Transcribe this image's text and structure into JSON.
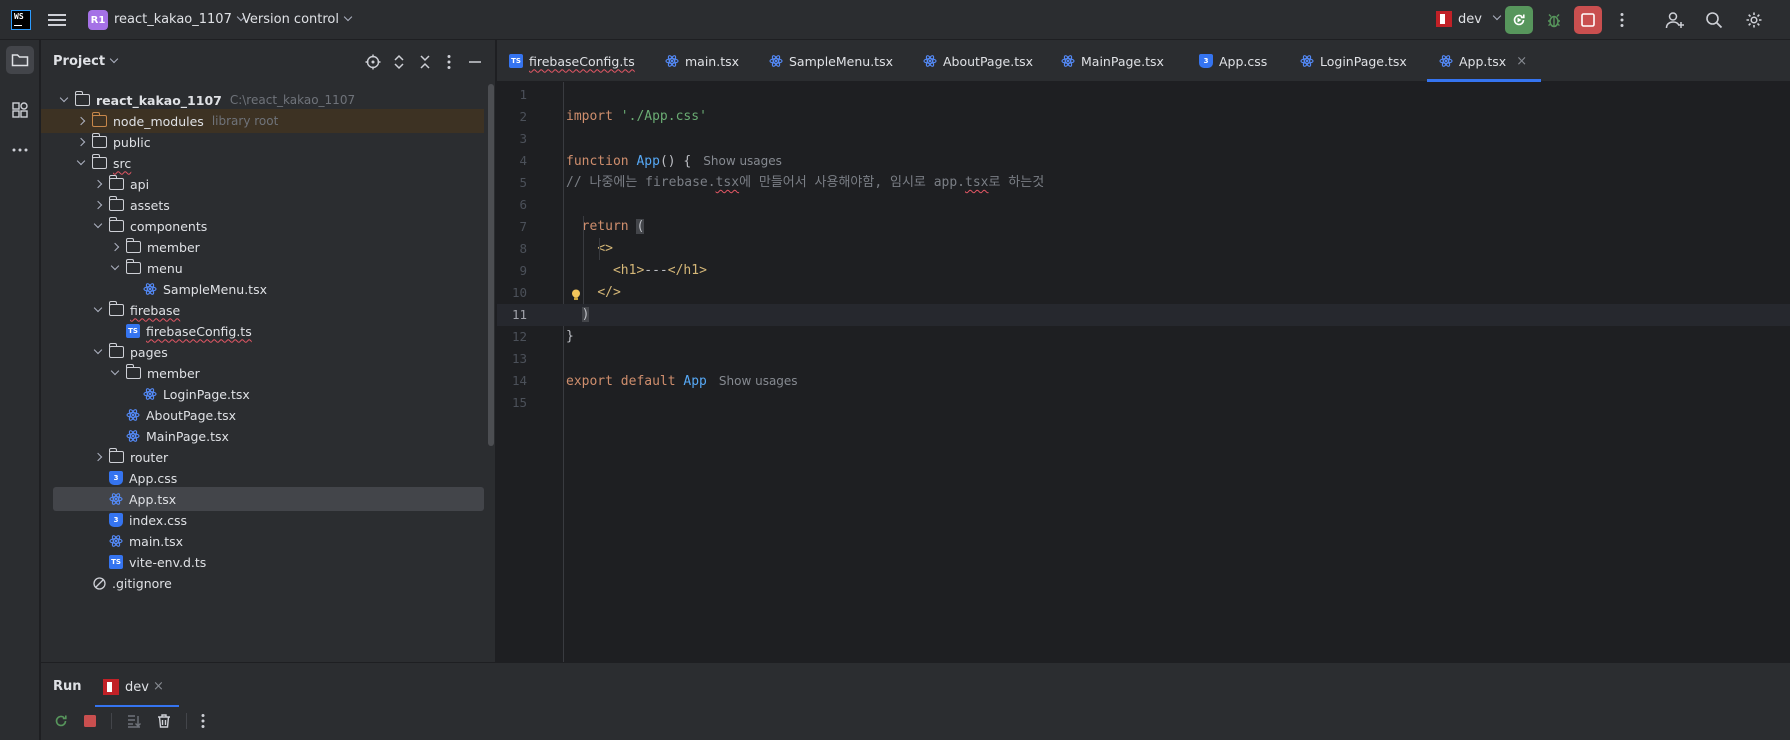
{
  "titlebar": {
    "logo": "WS",
    "project_badge": "R1",
    "project_name": "react_kakao_1107",
    "vcs_label": "Version control",
    "run_config": "dev"
  },
  "project_panel": {
    "title": "Project",
    "tree": [
      {
        "label": "react_kakao_1107",
        "hint": "C:\\react_kakao_1107",
        "type": "folder",
        "depth": 0,
        "expanded": true,
        "bold": true
      },
      {
        "label": "node_modules",
        "hint": "library root",
        "type": "folder-orange",
        "depth": 1,
        "expanded": false,
        "excluded": true
      },
      {
        "label": "public",
        "type": "folder",
        "depth": 1,
        "expanded": false
      },
      {
        "label": "src",
        "type": "folder",
        "depth": 1,
        "expanded": true,
        "wavy": true
      },
      {
        "label": "api",
        "type": "folder",
        "depth": 2,
        "expanded": false
      },
      {
        "label": "assets",
        "type": "folder",
        "depth": 2,
        "expanded": false
      },
      {
        "label": "components",
        "type": "folder",
        "depth": 2,
        "expanded": true
      },
      {
        "label": "member",
        "type": "folder",
        "depth": 3,
        "expanded": false
      },
      {
        "label": "menu",
        "type": "folder",
        "depth": 3,
        "expanded": true
      },
      {
        "label": "SampleMenu.tsx",
        "type": "react",
        "depth": 4
      },
      {
        "label": "firebase",
        "type": "folder",
        "depth": 2,
        "expanded": true,
        "wavy": true
      },
      {
        "label": "firebaseConfig.ts",
        "type": "ts",
        "depth": 3,
        "wavy": true
      },
      {
        "label": "pages",
        "type": "folder",
        "depth": 2,
        "expanded": true
      },
      {
        "label": "member",
        "type": "folder",
        "depth": 3,
        "expanded": true
      },
      {
        "label": "LoginPage.tsx",
        "type": "react",
        "depth": 4
      },
      {
        "label": "AboutPage.tsx",
        "type": "react",
        "depth": 3
      },
      {
        "label": "MainPage.tsx",
        "type": "react",
        "depth": 3
      },
      {
        "label": "router",
        "type": "folder",
        "depth": 2,
        "expanded": false
      },
      {
        "label": "App.css",
        "type": "css",
        "depth": 2
      },
      {
        "label": "App.tsx",
        "type": "react",
        "depth": 2,
        "selected": true
      },
      {
        "label": "index.css",
        "type": "css",
        "depth": 2
      },
      {
        "label": "main.tsx",
        "type": "react",
        "depth": 2
      },
      {
        "label": "vite-env.d.ts",
        "type": "ts",
        "depth": 2
      },
      {
        "label": ".gitignore",
        "type": "ignore",
        "depth": 1
      }
    ]
  },
  "tabs": [
    {
      "label": "firebaseConfig.ts",
      "type": "ts",
      "wavy": true
    },
    {
      "label": "main.tsx",
      "type": "react"
    },
    {
      "label": "SampleMenu.tsx",
      "type": "react"
    },
    {
      "label": "AboutPage.tsx",
      "type": "react"
    },
    {
      "label": "MainPage.tsx",
      "type": "react"
    },
    {
      "label": "App.css",
      "type": "css"
    },
    {
      "label": "LoginPage.tsx",
      "type": "react"
    },
    {
      "label": "App.tsx",
      "type": "react",
      "active": true,
      "close": "×"
    }
  ],
  "editor": {
    "lines": [
      {
        "n": "1",
        "tokens": []
      },
      {
        "n": "2",
        "tokens": [
          {
            "c": "kw",
            "t": "import "
          },
          {
            "c": "str",
            "t": "'./App.css'"
          }
        ]
      },
      {
        "n": "3",
        "tokens": []
      },
      {
        "n": "4",
        "tokens": [
          {
            "c": "kw",
            "t": "function "
          },
          {
            "c": "fn",
            "t": "App"
          },
          {
            "c": "",
            "t": "() {"
          }
        ],
        "inlay": "Show usages"
      },
      {
        "n": "5",
        "tokens": [
          {
            "c": "cmt",
            "t": "// 나중에는 firebase."
          },
          {
            "c": "cmt wavy",
            "t": "tsx"
          },
          {
            "c": "cmt",
            "t": "에 만들어서 사용해야함, 임시로 app."
          },
          {
            "c": "cmt wavy",
            "t": "tsx"
          },
          {
            "c": "cmt",
            "t": "로 하는것"
          }
        ]
      },
      {
        "n": "6",
        "tokens": []
      },
      {
        "n": "7",
        "tokens": [
          {
            "c": "",
            "t": "  "
          },
          {
            "c": "kw",
            "t": "return "
          },
          {
            "c": "bracket-hl",
            "t": "("
          }
        ]
      },
      {
        "n": "8",
        "tokens": [
          {
            "c": "",
            "t": "    "
          },
          {
            "c": "tag",
            "t": "<>"
          }
        ]
      },
      {
        "n": "9",
        "tokens": [
          {
            "c": "",
            "t": "      "
          },
          {
            "c": "tag",
            "t": "<h1>"
          },
          {
            "c": "",
            "t": "---"
          },
          {
            "c": "tag",
            "t": "</h1>"
          }
        ]
      },
      {
        "n": "10",
        "tokens": [
          {
            "c": "",
            "t": "    "
          },
          {
            "c": "tag",
            "t": "</>"
          }
        ],
        "bulb": true
      },
      {
        "n": "11",
        "tokens": [
          {
            "c": "",
            "t": "  "
          },
          {
            "c": "bracket-hl",
            "t": ")"
          }
        ],
        "current": true
      },
      {
        "n": "12",
        "tokens": [
          {
            "c": "",
            "t": "}"
          }
        ]
      },
      {
        "n": "13",
        "tokens": []
      },
      {
        "n": "14",
        "tokens": [
          {
            "c": "kw",
            "t": "export default "
          },
          {
            "c": "fn",
            "t": "App"
          }
        ],
        "inlay": "Show usages"
      },
      {
        "n": "15",
        "tokens": []
      }
    ]
  },
  "run_panel": {
    "title": "Run",
    "tab_label": "dev",
    "close": "×"
  },
  "colors": {
    "accent": "#3574f0",
    "run_green": "#57965c",
    "stop_red": "#c94f4f",
    "badge_purple": "#a571e6"
  }
}
